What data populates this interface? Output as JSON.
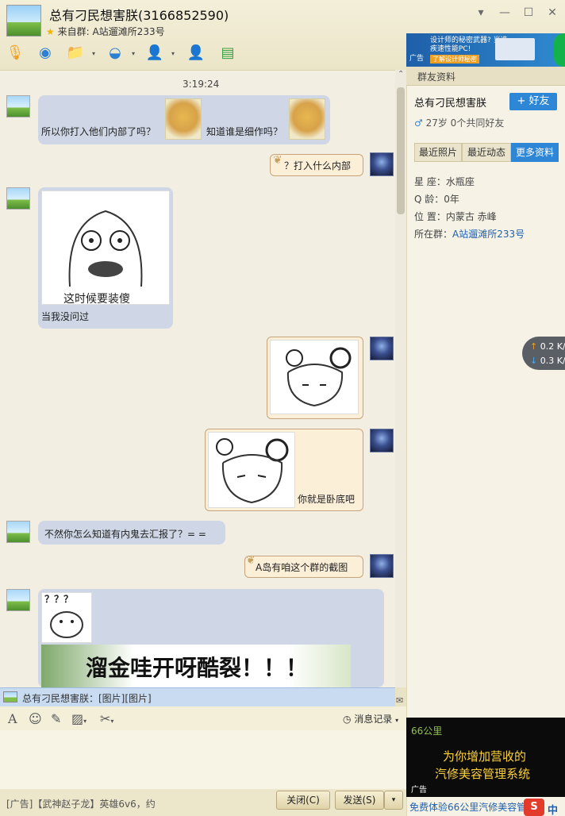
{
  "header": {
    "title": "总有刁民想害朕(3166852590)",
    "subtitle_prefix": "来自群:",
    "subtitle_group": "A站遛滩所233号",
    "win_buttons": {
      "menu": "▾",
      "min": "—",
      "max": "☐",
      "close": "✕"
    }
  },
  "chat": {
    "timestamp": "3:19:24",
    "messages": [
      {
        "side": "left",
        "text1": "所以你打入他们内部了吗？",
        "text2": "知道谁是细作吗？"
      },
      {
        "side": "right",
        "text": "？打入什么内部"
      },
      {
        "side": "left",
        "sketch_caption": "这时候要装傻",
        "text": "当我没问过"
      },
      {
        "side": "right",
        "type": "image"
      },
      {
        "side": "right",
        "sketch_caption": "你就是卧底吧"
      },
      {
        "side": "left",
        "text": "不然你怎么知道有内鬼去汇报了？= ="
      },
      {
        "side": "right",
        "text": "A岛有咱这个群的截图"
      },
      {
        "side": "left",
        "meme_top": "？？？",
        "meme_banner": "溜金哇开呀酷裂！！！"
      }
    ]
  },
  "notice": {
    "text": "总有刁民想害朕：[图片][图片]"
  },
  "input": {
    "history_label": "消息记录",
    "ad_text": "[广告]【武神赵子龙】英雄6v6，约",
    "close_label": "关闭(C)",
    "send_label": "发送(S)"
  },
  "right": {
    "ad_top_text": "设计师的秘密武器? 当选疾速性能PC!",
    "ad_top_sub": "了解设计师秘密",
    "ad_label": "广告",
    "tab_label": "群友资料",
    "name": "总有刁民想害朕",
    "add_friend": "+ 好友",
    "mutual": "27岁  0个共同好友",
    "tabs": [
      "最近照片",
      "最近动态",
      "更多资料"
    ],
    "info": {
      "constellation_label": "星    座：",
      "constellation": "水瓶座",
      "qage_label": "Q    龄：",
      "qage": "0年",
      "location_label": "位    置：",
      "location": "内蒙古 赤峰",
      "group_label": "所在群：",
      "group": "A站遛滩所233号"
    },
    "speed_up": "0.2",
    "speed_down": "0.3",
    "speed_unit": "K/s",
    "ad_bottom_logo": "66公里",
    "ad_bottom_line1": "为你增加营收的",
    "ad_bottom_line2": "汽修美容管理系统",
    "ad_bottom_label": "广告",
    "ad_link": "免费体验66公里汽修美容管",
    "ime_icon": "S",
    "ime_lang": "中"
  },
  "colors": {
    "accent": "#2e86d6",
    "bubble_left": "#cfd7e6",
    "bubble_right": "#fcefd8"
  }
}
